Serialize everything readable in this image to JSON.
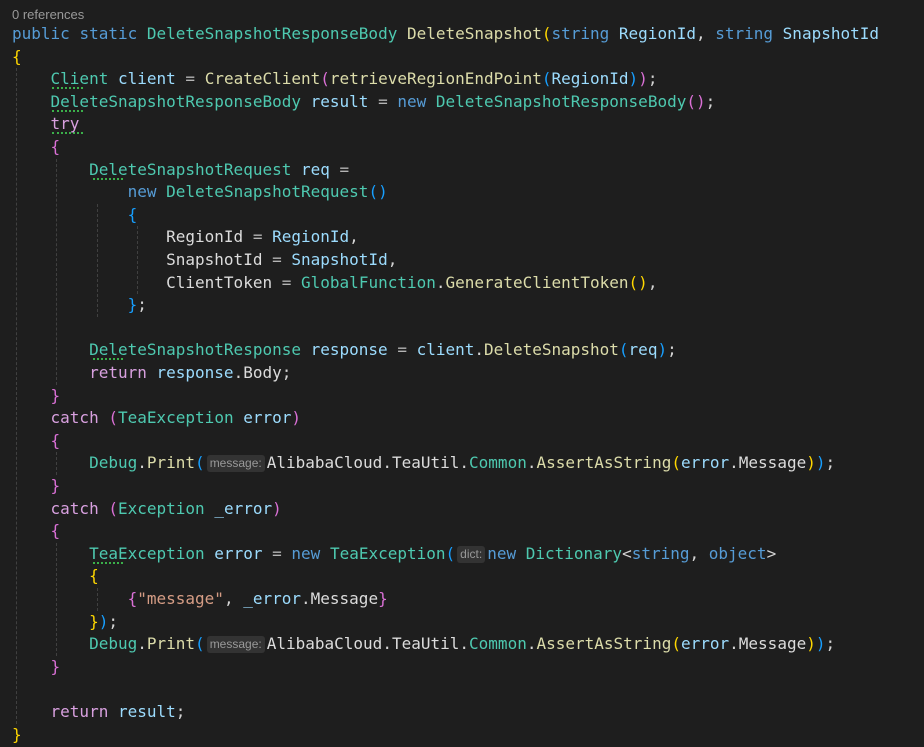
{
  "code_lens": "0 references",
  "colors": {
    "background": "#1e1e1e",
    "keyword": "#569cd6",
    "control": "#d8a0df",
    "type": "#4ec9b0",
    "method": "#dcdcaa",
    "variable": "#9cdcfe",
    "string": "#d69d85"
  },
  "hints": {
    "message": "message:",
    "dict": "dict:"
  },
  "lines": [
    [
      [
        "kw",
        "public"
      ],
      [
        "pun",
        " "
      ],
      [
        "kw",
        "static"
      ],
      [
        "pun",
        " "
      ],
      [
        "ty",
        "DeleteSnapshotResponseBody"
      ],
      [
        "pun",
        " "
      ],
      [
        "mth",
        "DeleteSnapshot"
      ],
      [
        "br1",
        "("
      ],
      [
        "kw",
        "string"
      ],
      [
        "pun",
        " "
      ],
      [
        "var",
        "RegionId"
      ],
      [
        "pun",
        ", "
      ],
      [
        "kw",
        "string"
      ],
      [
        "pun",
        " "
      ],
      [
        "var",
        "SnapshotId"
      ]
    ],
    [
      [
        "br1",
        "{"
      ]
    ],
    [
      [
        "pun",
        "    "
      ],
      [
        "ty",
        "Client"
      ],
      [
        "pun",
        " "
      ],
      [
        "var",
        "client"
      ],
      [
        "pun",
        " "
      ],
      [
        "op",
        "="
      ],
      [
        "pun",
        " "
      ],
      [
        "mth",
        "CreateClient"
      ],
      [
        "br2",
        "("
      ],
      [
        "mth",
        "retrieveRegionEndPoint"
      ],
      [
        "br3",
        "("
      ],
      [
        "var",
        "RegionId"
      ],
      [
        "br3",
        ")"
      ],
      [
        "br2",
        ")"
      ],
      [
        "pun",
        ";"
      ]
    ],
    [
      [
        "pun",
        "    "
      ],
      [
        "ty",
        "DeleteSnapshotResponseBody"
      ],
      [
        "pun",
        " "
      ],
      [
        "var",
        "result"
      ],
      [
        "pun",
        " "
      ],
      [
        "op",
        "="
      ],
      [
        "pun",
        " "
      ],
      [
        "kw",
        "new"
      ],
      [
        "pun",
        " "
      ],
      [
        "ty",
        "DeleteSnapshotResponseBody"
      ],
      [
        "br2",
        "()"
      ],
      [
        "pun",
        ";"
      ]
    ],
    [
      [
        "pun",
        "    "
      ],
      [
        "ctl",
        "try"
      ]
    ],
    [
      [
        "pun",
        "    "
      ],
      [
        "br2",
        "{"
      ]
    ],
    [
      [
        "pun",
        "        "
      ],
      [
        "ty",
        "DeleteSnapshotRequest"
      ],
      [
        "pun",
        " "
      ],
      [
        "var",
        "req"
      ],
      [
        "pun",
        " "
      ],
      [
        "op",
        "="
      ]
    ],
    [
      [
        "pun",
        "            "
      ],
      [
        "kw",
        "new"
      ],
      [
        "pun",
        " "
      ],
      [
        "ty",
        "DeleteSnapshotRequest"
      ],
      [
        "br3",
        "()"
      ]
    ],
    [
      [
        "pun",
        "            "
      ],
      [
        "br3",
        "{"
      ]
    ],
    [
      [
        "pun",
        "                "
      ],
      [
        "plain",
        "RegionId"
      ],
      [
        "pun",
        " "
      ],
      [
        "op",
        "="
      ],
      [
        "pun",
        " "
      ],
      [
        "var",
        "RegionId"
      ],
      [
        "pun",
        ","
      ]
    ],
    [
      [
        "pun",
        "                "
      ],
      [
        "plain",
        "SnapshotId"
      ],
      [
        "pun",
        " "
      ],
      [
        "op",
        "="
      ],
      [
        "pun",
        " "
      ],
      [
        "var",
        "SnapshotId"
      ],
      [
        "pun",
        ","
      ]
    ],
    [
      [
        "pun",
        "                "
      ],
      [
        "plain",
        "ClientToken"
      ],
      [
        "pun",
        " "
      ],
      [
        "op",
        "="
      ],
      [
        "pun",
        " "
      ],
      [
        "ty",
        "GlobalFunction"
      ],
      [
        "pun",
        "."
      ],
      [
        "mth",
        "GenerateClientToken"
      ],
      [
        "br1",
        "()"
      ],
      [
        "pun",
        ","
      ]
    ],
    [
      [
        "pun",
        "            "
      ],
      [
        "br3",
        "}"
      ],
      [
        "pun",
        ";"
      ]
    ],
    [
      [
        "pun",
        ""
      ]
    ],
    [
      [
        "pun",
        "        "
      ],
      [
        "ty",
        "DeleteSnapshotResponse"
      ],
      [
        "pun",
        " "
      ],
      [
        "var",
        "response"
      ],
      [
        "pun",
        " "
      ],
      [
        "op",
        "="
      ],
      [
        "pun",
        " "
      ],
      [
        "var",
        "client"
      ],
      [
        "pun",
        "."
      ],
      [
        "mth",
        "DeleteSnapshot"
      ],
      [
        "br3",
        "("
      ],
      [
        "var",
        "req"
      ],
      [
        "br3",
        ")"
      ],
      [
        "pun",
        ";"
      ]
    ],
    [
      [
        "pun",
        "        "
      ],
      [
        "ctl",
        "return"
      ],
      [
        "pun",
        " "
      ],
      [
        "var",
        "response"
      ],
      [
        "pun",
        "."
      ],
      [
        "plain",
        "Body"
      ],
      [
        "pun",
        ";"
      ]
    ],
    [
      [
        "pun",
        "    "
      ],
      [
        "br2",
        "}"
      ]
    ],
    [
      [
        "pun",
        "    "
      ],
      [
        "ctl",
        "catch"
      ],
      [
        "pun",
        " "
      ],
      [
        "br2",
        "("
      ],
      [
        "ty",
        "TeaException"
      ],
      [
        "pun",
        " "
      ],
      [
        "var",
        "error"
      ],
      [
        "br2",
        ")"
      ]
    ],
    [
      [
        "pun",
        "    "
      ],
      [
        "br2",
        "{"
      ]
    ],
    [
      [
        "pun",
        "        "
      ],
      [
        "ty",
        "Debug"
      ],
      [
        "pun",
        "."
      ],
      [
        "mth",
        "Print"
      ],
      [
        "br3",
        "("
      ],
      [
        "hint",
        "message"
      ],
      [
        "plain",
        "AlibabaCloud"
      ],
      [
        "pun",
        "."
      ],
      [
        "plain",
        "TeaUtil"
      ],
      [
        "pun",
        "."
      ],
      [
        "ty",
        "Common"
      ],
      [
        "pun",
        "."
      ],
      [
        "mth",
        "AssertAsString"
      ],
      [
        "br1",
        "("
      ],
      [
        "var",
        "error"
      ],
      [
        "pun",
        "."
      ],
      [
        "plain",
        "Message"
      ],
      [
        "br1",
        ")"
      ],
      [
        "br3",
        ")"
      ],
      [
        "pun",
        ";"
      ]
    ],
    [
      [
        "pun",
        "    "
      ],
      [
        "br2",
        "}"
      ]
    ],
    [
      [
        "pun",
        "    "
      ],
      [
        "ctl",
        "catch"
      ],
      [
        "pun",
        " "
      ],
      [
        "br2",
        "("
      ],
      [
        "ty",
        "Exception"
      ],
      [
        "pun",
        " "
      ],
      [
        "var",
        "_error"
      ],
      [
        "br2",
        ")"
      ]
    ],
    [
      [
        "pun",
        "    "
      ],
      [
        "br2",
        "{"
      ]
    ],
    [
      [
        "pun",
        "        "
      ],
      [
        "ty",
        "TeaException"
      ],
      [
        "pun",
        " "
      ],
      [
        "var",
        "error"
      ],
      [
        "pun",
        " "
      ],
      [
        "op",
        "="
      ],
      [
        "pun",
        " "
      ],
      [
        "kw",
        "new"
      ],
      [
        "pun",
        " "
      ],
      [
        "ty",
        "TeaException"
      ],
      [
        "br3",
        "("
      ],
      [
        "hint",
        "dict"
      ],
      [
        "kw",
        "new"
      ],
      [
        "pun",
        " "
      ],
      [
        "ty",
        "Dictionary"
      ],
      [
        "pun",
        "<"
      ],
      [
        "kw",
        "string"
      ],
      [
        "pun",
        ", "
      ],
      [
        "kw",
        "object"
      ],
      [
        "pun",
        ">"
      ]
    ],
    [
      [
        "pun",
        "        "
      ],
      [
        "br1",
        "{"
      ]
    ],
    [
      [
        "pun",
        "            "
      ],
      [
        "br2",
        "{"
      ],
      [
        "str",
        "\"message\""
      ],
      [
        "pun",
        ", "
      ],
      [
        "var",
        "_error"
      ],
      [
        "pun",
        "."
      ],
      [
        "plain",
        "Message"
      ],
      [
        "br2",
        "}"
      ]
    ],
    [
      [
        "pun",
        "        "
      ],
      [
        "br1",
        "}"
      ],
      [
        "br3",
        ")"
      ],
      [
        "pun",
        ";"
      ]
    ],
    [
      [
        "pun",
        "        "
      ],
      [
        "ty",
        "Debug"
      ],
      [
        "pun",
        "."
      ],
      [
        "mth",
        "Print"
      ],
      [
        "br3",
        "("
      ],
      [
        "hint",
        "message"
      ],
      [
        "plain",
        "AlibabaCloud"
      ],
      [
        "pun",
        "."
      ],
      [
        "plain",
        "TeaUtil"
      ],
      [
        "pun",
        "."
      ],
      [
        "ty",
        "Common"
      ],
      [
        "pun",
        "."
      ],
      [
        "mth",
        "AssertAsString"
      ],
      [
        "br1",
        "("
      ],
      [
        "var",
        "error"
      ],
      [
        "pun",
        "."
      ],
      [
        "plain",
        "Message"
      ],
      [
        "br1",
        ")"
      ],
      [
        "br3",
        ")"
      ],
      [
        "pun",
        ";"
      ]
    ],
    [
      [
        "pun",
        "    "
      ],
      [
        "br2",
        "}"
      ]
    ],
    [
      [
        "pun",
        ""
      ]
    ],
    [
      [
        "pun",
        "    "
      ],
      [
        "ctl",
        "return"
      ],
      [
        "pun",
        " "
      ],
      [
        "var",
        "result"
      ],
      [
        "pun",
        ";"
      ]
    ],
    [
      [
        "br1",
        "}"
      ]
    ]
  ]
}
